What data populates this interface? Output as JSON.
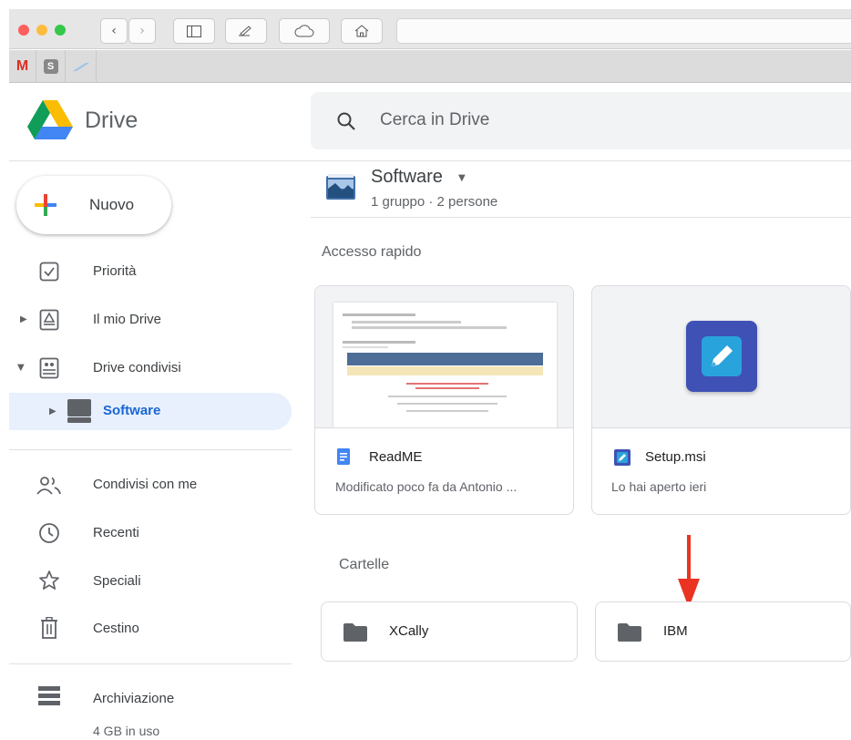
{
  "browser": {
    "bookmarks": [
      "M",
      "S"
    ]
  },
  "app": {
    "name": "Drive"
  },
  "search": {
    "placeholder": "Cerca in Drive"
  },
  "new_button": {
    "label": "Nuovo"
  },
  "sidebar": {
    "items": [
      {
        "label": "Priorità",
        "icon": "priority-icon"
      },
      {
        "label": "Il mio Drive",
        "icon": "my-drive-icon"
      },
      {
        "label": "Drive condivisi",
        "icon": "shared-drives-icon"
      },
      {
        "label": "Software",
        "icon": "shared-drive-icon",
        "selected": true
      },
      {
        "label": "Condivisi con me",
        "icon": "people-icon"
      },
      {
        "label": "Recenti",
        "icon": "clock-icon"
      },
      {
        "label": "Speciali",
        "icon": "star-icon"
      },
      {
        "label": "Cestino",
        "icon": "trash-icon"
      }
    ],
    "storage": {
      "label": "Archiviazione",
      "usage": "4 GB in uso"
    }
  },
  "header": {
    "title": "Software",
    "subtitle": "1 gruppo · 2 persone"
  },
  "quick_access": {
    "label": "Accesso rapido",
    "cards": [
      {
        "name": "ReadME",
        "detail": "Modificato poco fa da Antonio ...",
        "icon": "docs-icon"
      },
      {
        "name": "Setup.msi",
        "detail": "Lo hai aperto ieri",
        "icon": "installer-icon"
      }
    ]
  },
  "folders": {
    "label": "Cartelle",
    "items": [
      {
        "name": "XCally"
      },
      {
        "name": "IBM"
      }
    ]
  },
  "colors": {
    "accent": "#1967d2",
    "selected_bg": "#e8f0fe",
    "arrow": "#ea3323"
  }
}
